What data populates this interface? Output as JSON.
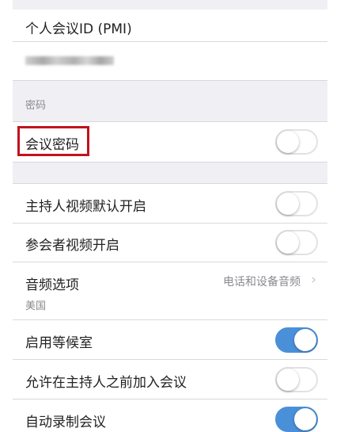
{
  "pmi_title": "个人会议ID (PMI)",
  "password_section_header": "密码",
  "meeting_password": {
    "label": "会议密码",
    "enabled": false
  },
  "settings": [
    {
      "label": "主持人视频默认开启",
      "enabled": false
    },
    {
      "label": "参会者视频开启",
      "enabled": false
    }
  ],
  "audio_option": {
    "label": "音频选项",
    "value": "电话和设备音频",
    "region": "美国"
  },
  "settings2": [
    {
      "label": "启用等候室",
      "enabled": true
    },
    {
      "label": "允许在主持人之前加入会议",
      "enabled": false
    },
    {
      "label": "自动录制会议",
      "enabled": true
    }
  ],
  "colors": {
    "toggle_on": "#4a90d9",
    "highlight": "#c1121f"
  },
  "icons": {
    "chevron": "chevron-right-icon"
  }
}
